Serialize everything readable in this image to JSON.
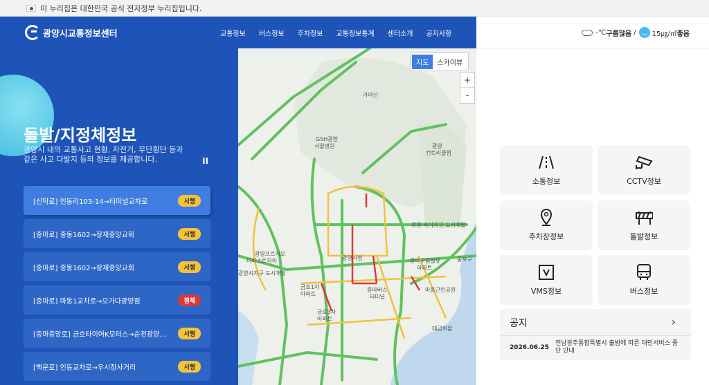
{
  "gov_banner": {
    "text": "이 누리집은 대한민국 공식 전자정부 누리집입니다."
  },
  "header": {
    "logo_text": "광양시교통정보센터",
    "nav": [
      "교통정보",
      "버스정보",
      "주차정보",
      "교통정보통계",
      "센터소개",
      "공지사항"
    ]
  },
  "weather": {
    "temp": "-℃",
    "condition": "구름많음",
    "separator": "/",
    "dust": "15㎍/㎥",
    "dust_level": "좋음"
  },
  "hero": {
    "title": "돌발/지정체정보",
    "description": "광양시 내의 교통사고 현황, 자전거, 무단횡단 등과 같은 사고 다발지 등의 정보를 제공합니다.",
    "pause_label": "II"
  },
  "incidents": [
    {
      "label": "[신덕로] 인동리103-14→터미널교차로",
      "status": "서행",
      "level": "slow",
      "active": true
    },
    {
      "label": "[중마로] 중동1602→장재중앙교회",
      "status": "서행",
      "level": "slow"
    },
    {
      "label": "[중마로] 중동1602→장재중앙교회",
      "status": "서행",
      "level": "slow"
    },
    {
      "label": "[중마로] 마동1교차로→오가다광양점",
      "status": "정체",
      "level": "jam"
    },
    {
      "label": "[중마중앙로] 금호타이어K모터스→순천광양축…",
      "status": "서행",
      "level": "slow"
    },
    {
      "label": "[백운로] 인동교차로→우시장사거리",
      "status": "서행",
      "level": "slow"
    }
  ],
  "map": {
    "toggle": [
      "지도",
      "스카이뷰"
    ],
    "zoom_in": "+",
    "zoom_out": "-",
    "labels": [
      {
        "text": "가야산"
      },
      {
        "text": "GSH광양"
      },
      {
        "text": "서울병원"
      },
      {
        "text": "광양"
      },
      {
        "text": "컨트리클럽"
      },
      {
        "text": "광양프르지오"
      },
      {
        "text": "더퍼스트하이"
      },
      {
        "text": "광양시청"
      },
      {
        "text": "중마우림필유"
      },
      {
        "text": "아파트"
      },
      {
        "text": "금호1차"
      },
      {
        "text": "아파트"
      },
      {
        "text": "중마버스"
      },
      {
        "text": "터미널"
      },
      {
        "text": "광양시지구 도시개발"
      },
      {
        "text": "금호3차"
      },
      {
        "text": "아파트"
      },
      {
        "text": "마동근린공원"
      },
      {
        "text": "태금화물"
      },
      {
        "text": "중포구"
      },
      {
        "text": "광양 와이지구 도시개발"
      }
    ]
  },
  "services": [
    {
      "label": "소통정보",
      "icon": "road-icon"
    },
    {
      "label": "CCTV정보",
      "icon": "cctv-icon"
    },
    {
      "label": "주차장정보",
      "icon": "parking-location-icon"
    },
    {
      "label": "돌발정보",
      "icon": "barricade-icon"
    },
    {
      "label": "VMS정보",
      "icon": "vms-sign-icon"
    },
    {
      "label": "버스정보",
      "icon": "bus-icon"
    }
  ],
  "notice": {
    "title": "공지",
    "arrow": "›",
    "items": [
      {
        "date": "2026.06.25",
        "text": "전남광주통합특별시 출범에 따른 대민서비스 중단 안내"
      }
    ]
  }
}
